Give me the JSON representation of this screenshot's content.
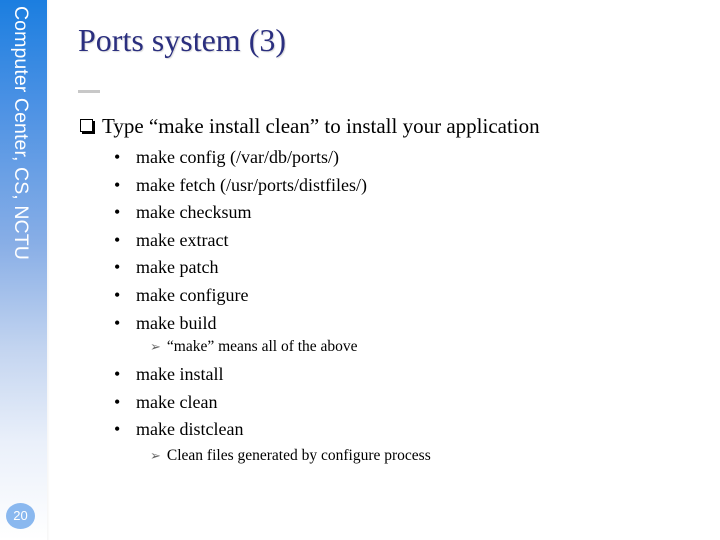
{
  "sidebar": {
    "title": "Computer Center, CS, NCTU",
    "page_number": "20"
  },
  "slide": {
    "title": "Ports system (3)",
    "main_point": "Type “make install clean” to install your application",
    "bullet_glyph": "•",
    "arrow_glyph": "➢",
    "list_a": [
      "make config (/var/db/ports/)",
      "make fetch (/usr/ports/distfiles/)",
      "make checksum",
      "make extract",
      "make patch",
      "make configure",
      "make build"
    ],
    "note_a": "“make” means all of the above",
    "list_b": [
      "make install",
      "make clean",
      "make distclean"
    ],
    "note_b": "Clean files generated by configure process"
  }
}
